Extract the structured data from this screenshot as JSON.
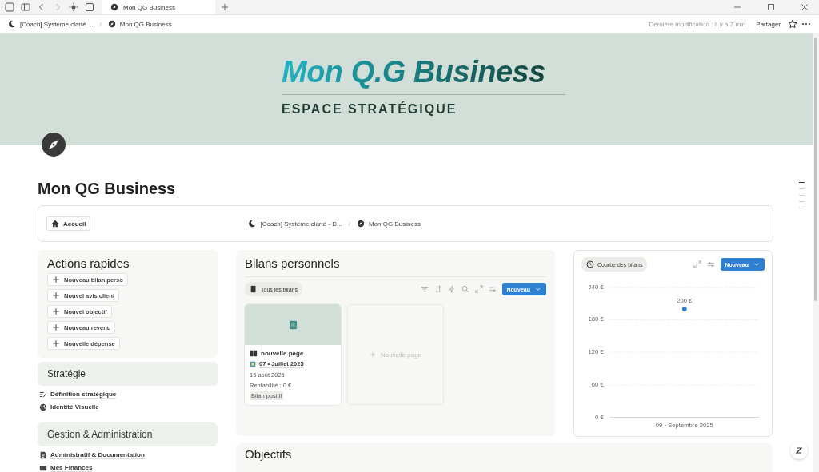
{
  "tabbar": {
    "tabs": [
      {
        "label": "Mon QG Business",
        "selected": true
      }
    ]
  },
  "topbar": {
    "breadcrumb": [
      "[Coach] Système clarté ...",
      "Mon QG Business"
    ],
    "separator": "/",
    "last_edit": "Dernière modification : Il y a 7 min",
    "share": "Partager"
  },
  "cover": {
    "title": "Mon Q.G Business",
    "subtitle": "ESPACE STRATÉGIQUE"
  },
  "page_title": "Mon QG Business",
  "nav": {
    "home": "Accueil",
    "breadcrumb": [
      "[Coach] Système clarté - D...",
      "Mon QG Business"
    ],
    "separator": "/"
  },
  "quick_actions": {
    "title": "Actions rapides",
    "buttons": [
      "Nouveau bilan perso",
      "Nouvel avis client",
      "Nouvel objectif",
      "Nouveau revenu",
      "Nouvelle dépense"
    ]
  },
  "sections": [
    {
      "title": "Stratégie",
      "links": [
        "Définition stratégique",
        "Identité Visuelle"
      ]
    },
    {
      "title": "Gestion & Administration",
      "links": [
        "Administratif & Documentation",
        "Mes Finances"
      ]
    }
  ],
  "bilans": {
    "title": "Bilans personnels",
    "view": "Tous les bilans",
    "new_button": "Nouveau",
    "add_label": "Nouvelle page",
    "cards": [
      {
        "title": "nouvelle page",
        "period": "07 • Juillet 2025",
        "date": "15 août 2025",
        "rentabilite": "Rentabilité : 0 €",
        "tag": "Bilan positif"
      }
    ]
  },
  "courbe": {
    "view": "Courbe des bilans",
    "new_button": "Nouveau",
    "chart_data": {
      "type": "scatter",
      "categories": [
        "09 • Septembre 2025"
      ],
      "series": [
        {
          "color": "#2f80d1",
          "values": [
            200
          ]
        }
      ],
      "ylim": [
        0,
        240
      ],
      "grid": true,
      "yticks": [
        {
          "value": 0,
          "label": "0 €"
        },
        {
          "value": 60,
          "label": "60 €"
        },
        {
          "value": 120,
          "label": "120 €"
        },
        {
          "value": 180,
          "label": "180 €"
        },
        {
          "value": 240,
          "label": "240 €"
        }
      ],
      "value_labels": [
        "200 €"
      ]
    }
  },
  "objectifs": {
    "title": "Objectifs"
  }
}
